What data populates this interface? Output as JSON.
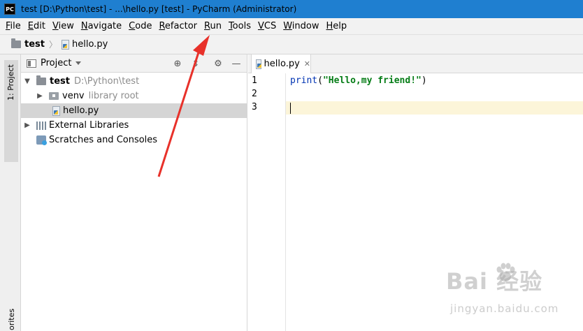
{
  "window": {
    "title": "test [D:\\Python\\test] - ...\\hello.py [test] - PyCharm (Administrator)",
    "logo_text": "PC"
  },
  "menu": [
    {
      "label": "File",
      "mnemonic": "F",
      "rest": "ile"
    },
    {
      "label": "Edit",
      "mnemonic": "E",
      "rest": "dit"
    },
    {
      "label": "View",
      "mnemonic": "V",
      "rest": "iew"
    },
    {
      "label": "Navigate",
      "mnemonic": "N",
      "rest": "avigate"
    },
    {
      "label": "Code",
      "mnemonic": "C",
      "rest": "ode"
    },
    {
      "label": "Refactor",
      "mnemonic": "R",
      "rest": "efactor"
    },
    {
      "label": "Run",
      "mnemonic": "R",
      "rest": "un"
    },
    {
      "label": "Tools",
      "mnemonic": "T",
      "rest": "ools"
    },
    {
      "label": "VCS",
      "mnemonic": "V",
      "rest": "CS"
    },
    {
      "label": "Window",
      "mnemonic": "W",
      "rest": "indow"
    },
    {
      "label": "Help",
      "mnemonic": "H",
      "rest": "elp"
    }
  ],
  "breadcrumb": {
    "project": "test",
    "file": "hello.py"
  },
  "left_strip": {
    "project_tab": "1: Project",
    "bottom_tab": "orites"
  },
  "project_panel": {
    "title": "Project",
    "tree": [
      {
        "name": "test",
        "extra": "D:\\Python\\test"
      },
      {
        "name": "venv",
        "extra": "library root"
      },
      {
        "name": "hello.py",
        "extra": ""
      },
      {
        "name": "External Libraries",
        "extra": ""
      },
      {
        "name": "Scratches and Consoles",
        "extra": ""
      }
    ]
  },
  "editor": {
    "tab_label": "hello.py",
    "line_numbers": [
      "1",
      "2",
      "3"
    ],
    "code": {
      "func": "print",
      "open": "(",
      "string": "\"Hello,my friend!\"",
      "close": ")"
    },
    "current_line": 3
  },
  "watermark": {
    "main": "Bai  经验",
    "sub": "jingyan.baidu.com"
  },
  "colors": {
    "titlebar": "#1f7fd0",
    "annotation_arrow": "#e8312a",
    "current_line": "#fcf5d9",
    "keyword": "#0033b3",
    "string": "#067d17"
  }
}
